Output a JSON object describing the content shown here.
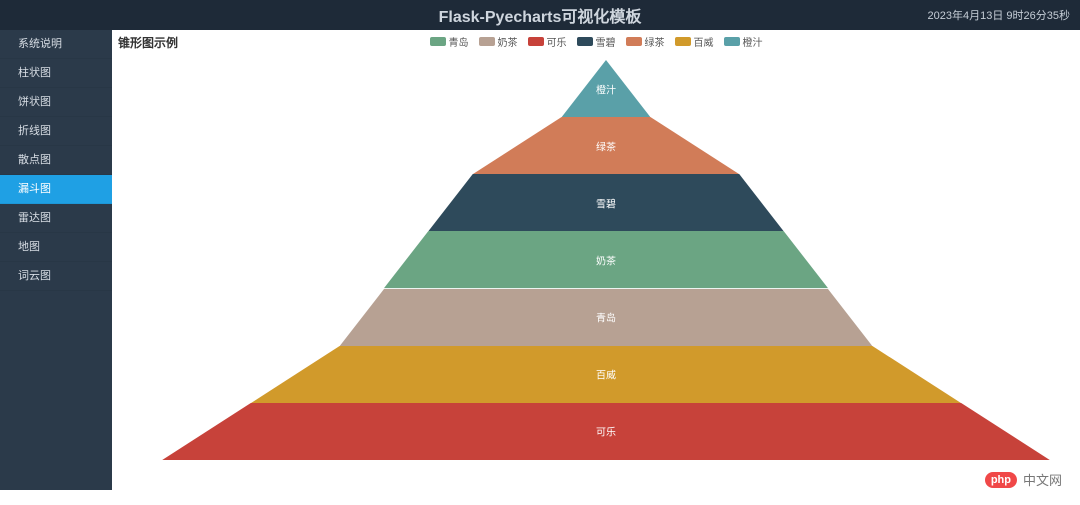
{
  "header": {
    "title": "Flask-Pyecharts可视化模板",
    "timestamp": "2023年4月13日  9时26分35秒"
  },
  "sidebar": {
    "items": [
      {
        "label": "系统说明",
        "active": false
      },
      {
        "label": "柱状图",
        "active": false
      },
      {
        "label": "饼状图",
        "active": false
      },
      {
        "label": "折线图",
        "active": false
      },
      {
        "label": "散点图",
        "active": false
      },
      {
        "label": "漏斗图",
        "active": true
      },
      {
        "label": "雷达图",
        "active": false
      },
      {
        "label": "地图",
        "active": false
      },
      {
        "label": "词云图",
        "active": false
      }
    ]
  },
  "chart": {
    "title": "锥形图示例"
  },
  "legend": [
    {
      "name": "青岛",
      "color": "#6ba583"
    },
    {
      "name": "奶茶",
      "color": "#b7a193"
    },
    {
      "name": "可乐",
      "color": "#c7423a"
    },
    {
      "name": "雪碧",
      "color": "#2e4a5b"
    },
    {
      "name": "绿茶",
      "color": "#d17c58"
    },
    {
      "name": "百威",
      "color": "#d19a2b"
    },
    {
      "name": "橙汁",
      "color": "#5aa0a8"
    }
  ],
  "chart_data": {
    "type": "pyramid",
    "title": "锥形图示例",
    "sort": "ascending",
    "series": [
      {
        "name": "橙汁",
        "value": 10,
        "color": "#5aa0a8"
      },
      {
        "name": "绿茶",
        "value": 30,
        "color": "#d17c58"
      },
      {
        "name": "雪碧",
        "value": 40,
        "color": "#2e4a5b"
      },
      {
        "name": "奶茶",
        "value": 50,
        "color": "#6ba583"
      },
      {
        "name": "青岛",
        "value": 60,
        "color": "#b7a193"
      },
      {
        "name": "百威",
        "value": 80,
        "color": "#d19a2b"
      },
      {
        "name": "可乐",
        "value": 100,
        "color": "#c7423a"
      }
    ]
  },
  "watermark": {
    "badge": "php",
    "text": "中文网"
  }
}
